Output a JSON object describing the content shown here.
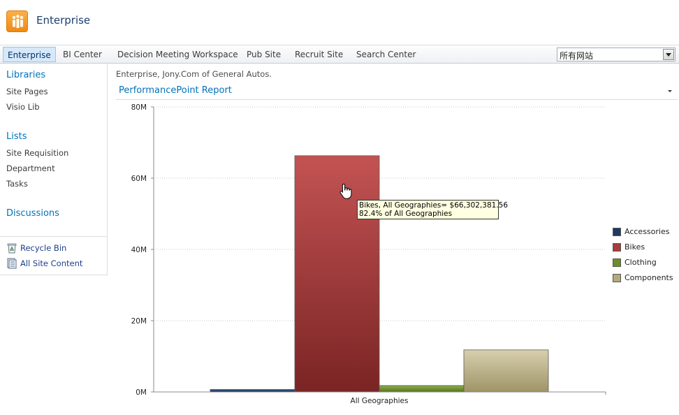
{
  "header": {
    "site_title": "Enterprise",
    "logo_icon": "people-logo-icon"
  },
  "topnav": {
    "tabs": [
      {
        "label": "Enterprise",
        "active": true
      },
      {
        "label": "BI Center"
      },
      {
        "label": "Decision Meeting Workspace"
      },
      {
        "label": "Pub Site"
      },
      {
        "label": "Recruit Site"
      },
      {
        "label": "Search Center"
      }
    ],
    "scope_select": {
      "value": "所有网站"
    }
  },
  "leftnav": {
    "libraries": {
      "heading": "Libraries",
      "items": [
        "Site Pages",
        "Visio Lib"
      ]
    },
    "lists": {
      "heading": "Lists",
      "items": [
        "Site Requisition",
        "Department",
        "Tasks"
      ]
    },
    "discussions": {
      "heading": "Discussions"
    },
    "utility": [
      {
        "label": "Recycle Bin",
        "icon": "recycle-bin-icon"
      },
      {
        "label": "All Site Content",
        "icon": "site-content-icon"
      }
    ]
  },
  "main": {
    "breadcrumb": "Enterprise, Jony.Com of General Autos.",
    "webpart_title": "PerformancePoint Report"
  },
  "chart_data": {
    "type": "bar",
    "categories": [
      "All Geographies"
    ],
    "series": [
      {
        "name": "Accessories",
        "values": [
          700000
        ],
        "color": "#1f3864"
      },
      {
        "name": "Bikes",
        "values": [
          66302381.56
        ],
        "color": "#a93c3c"
      },
      {
        "name": "Clothing",
        "values": [
          1800000
        ],
        "color": "#6b8e2a"
      },
      {
        "name": "Components",
        "values": [
          11800000
        ],
        "color": "#b5aa7a"
      }
    ],
    "yticks": [
      "0M",
      "20M",
      "40M",
      "60M",
      "80M"
    ],
    "ylim": [
      0,
      80000000
    ],
    "grid": true,
    "legend_position": "right",
    "tooltip": {
      "line1": "Bikes, All Geographies= $66,302,381.56",
      "line2": "82.4% of All Geographies"
    }
  }
}
